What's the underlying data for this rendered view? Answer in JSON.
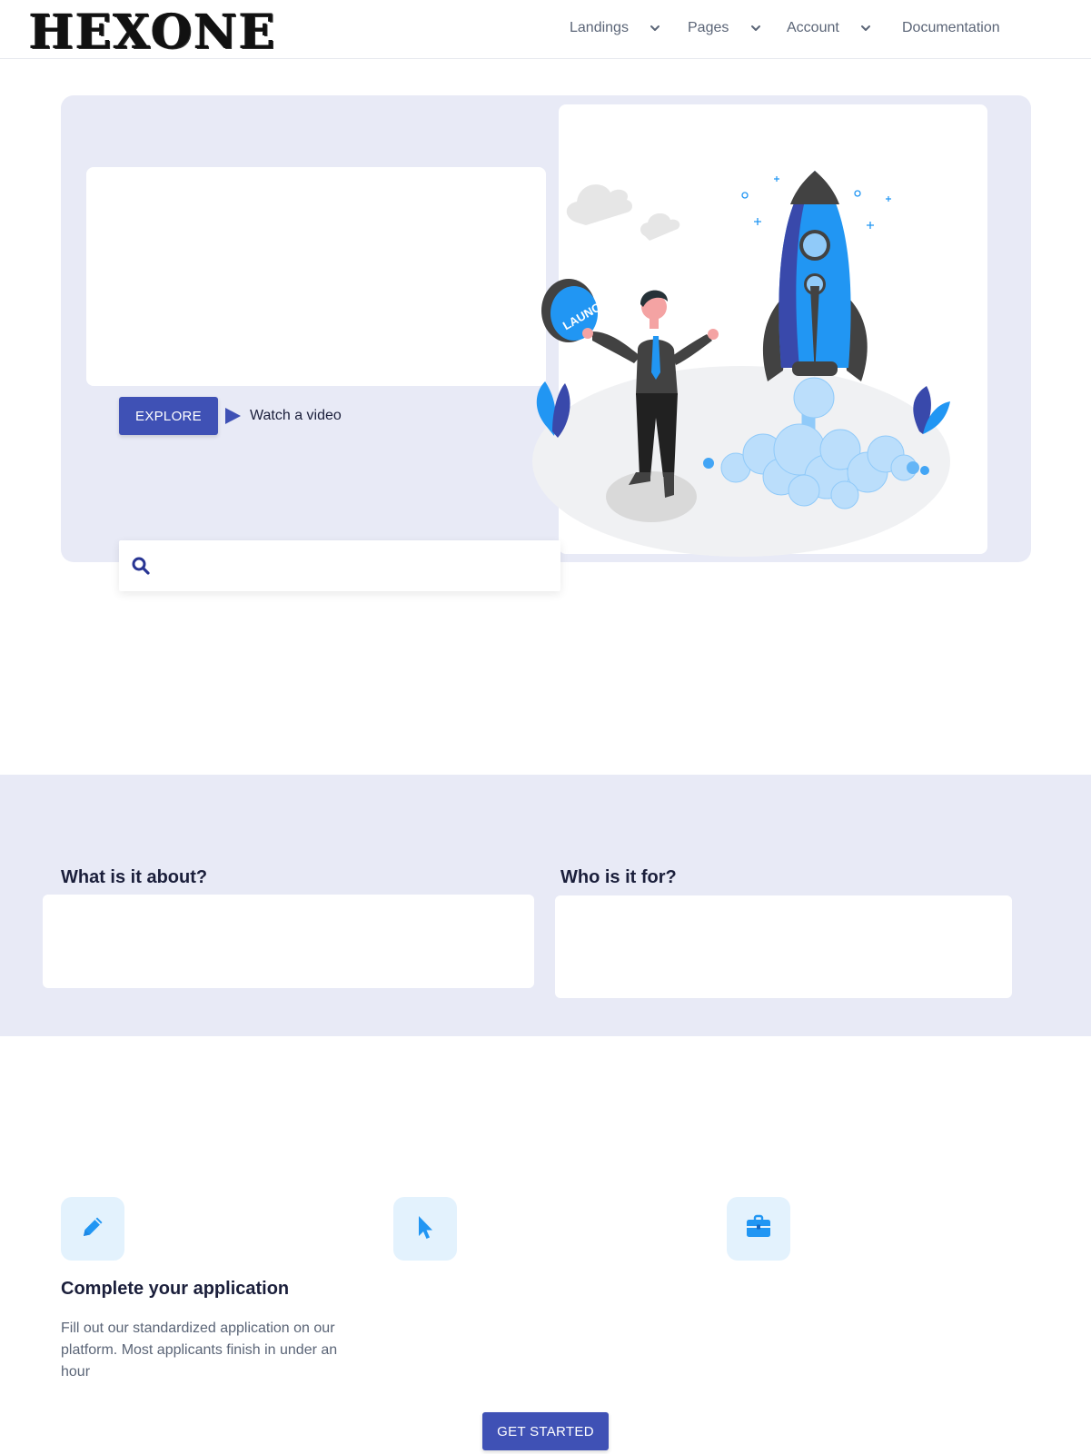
{
  "brand": {
    "logo_text": "HEXONE"
  },
  "nav": {
    "items": [
      {
        "label": "Landings",
        "dropdown": true
      },
      {
        "label": "Pages",
        "dropdown": true
      },
      {
        "label": "Account",
        "dropdown": true
      },
      {
        "label": "Documentation",
        "dropdown": false
      }
    ]
  },
  "hero": {
    "explore_label": "EXPLORE",
    "watch_label": "Watch a video",
    "search_placeholder": "",
    "illustration_button_text": "LAUNCH"
  },
  "about": {
    "left_title": "What is it about?",
    "right_title": "Who is it for?"
  },
  "features": {
    "items": [
      {
        "icon": "pencil-icon",
        "title": "Complete your application",
        "description": "Fill out our standardized application on our platform. Most applicants finish in under an hour"
      },
      {
        "icon": "cursor-icon",
        "title": "",
        "description": ""
      },
      {
        "icon": "briefcase-icon",
        "title": "",
        "description": ""
      }
    ],
    "cta_label": "GET STARTED"
  },
  "colors": {
    "primary": "#3f51b5",
    "section_bg": "#e8eaf6",
    "icon_tile_bg": "#e3f2fd",
    "icon_blue": "#2196f3"
  }
}
